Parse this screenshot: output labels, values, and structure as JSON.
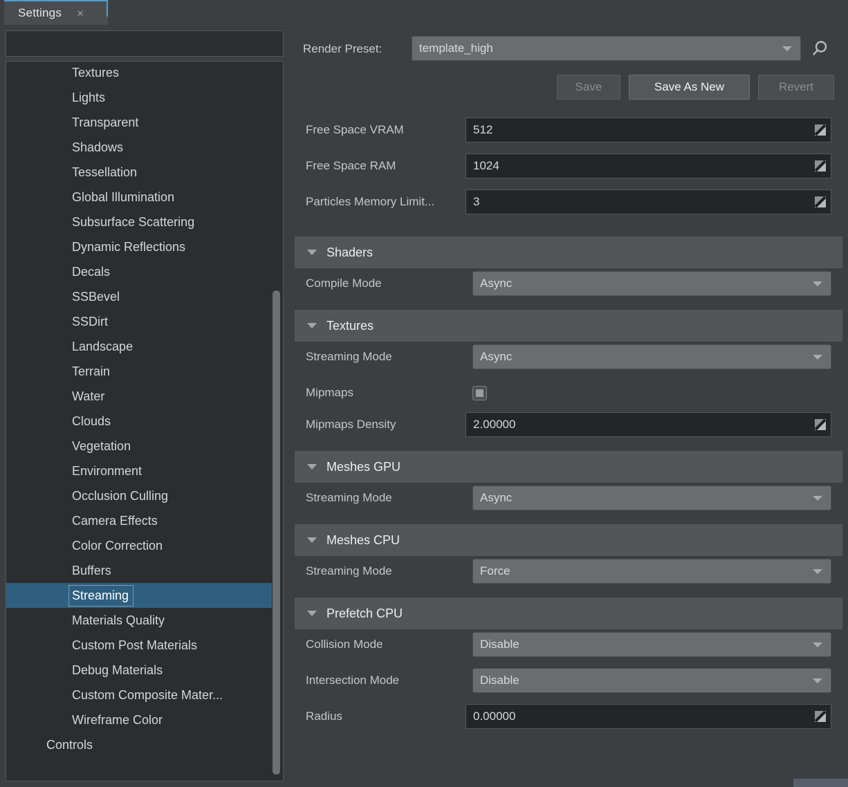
{
  "window": {
    "tab_label": "Settings",
    "close_icon": "close-icon"
  },
  "sidebar": {
    "search_placeholder": "",
    "search_value": "",
    "selected_item": "Streaming",
    "items": [
      {
        "label": "Textures",
        "level": 1
      },
      {
        "label": "Lights",
        "level": 1
      },
      {
        "label": "Transparent",
        "level": 1
      },
      {
        "label": "Shadows",
        "level": 1
      },
      {
        "label": "Tessellation",
        "level": 1
      },
      {
        "label": "Global Illumination",
        "level": 1
      },
      {
        "label": "Subsurface Scattering",
        "level": 1
      },
      {
        "label": "Dynamic Reflections",
        "level": 1
      },
      {
        "label": "Decals",
        "level": 1
      },
      {
        "label": "SSBevel",
        "level": 1
      },
      {
        "label": "SSDirt",
        "level": 1
      },
      {
        "label": "Landscape",
        "level": 1
      },
      {
        "label": "Terrain",
        "level": 1
      },
      {
        "label": "Water",
        "level": 1
      },
      {
        "label": "Clouds",
        "level": 1
      },
      {
        "label": "Vegetation",
        "level": 1
      },
      {
        "label": "Environment",
        "level": 1
      },
      {
        "label": "Occlusion Culling",
        "level": 1
      },
      {
        "label": "Camera Effects",
        "level": 1
      },
      {
        "label": "Color Correction",
        "level": 1
      },
      {
        "label": "Buffers",
        "level": 1
      },
      {
        "label": "Streaming",
        "level": 1,
        "selected": true
      },
      {
        "label": "Materials Quality",
        "level": 1
      },
      {
        "label": "Custom Post Materials",
        "level": 1
      },
      {
        "label": "Debug Materials",
        "level": 1
      },
      {
        "label": "Custom Composite Mater...",
        "level": 1
      },
      {
        "label": "Wireframe Color",
        "level": 1
      },
      {
        "label": "Controls",
        "level": 0
      }
    ]
  },
  "main": {
    "preset": {
      "label": "Render Preset:",
      "value": "template_high",
      "search_icon": "search-icon"
    },
    "buttons": {
      "save": {
        "label": "Save",
        "enabled": false
      },
      "save_as_new": {
        "label": "Save As New",
        "enabled": true
      },
      "revert": {
        "label": "Revert",
        "enabled": false
      }
    },
    "top_fields": [
      {
        "label": "Free Space VRAM",
        "value": "512",
        "type": "number"
      },
      {
        "label": "Free Space RAM",
        "value": "1024",
        "type": "number"
      },
      {
        "label": "Particles Memory Limit...",
        "value": "3",
        "type": "number"
      }
    ],
    "sections": [
      {
        "title": "Shaders",
        "expanded": true,
        "fields": [
          {
            "label": "Compile Mode",
            "value": "Async",
            "type": "select"
          }
        ]
      },
      {
        "title": "Textures",
        "expanded": true,
        "fields": [
          {
            "label": "Streaming Mode",
            "value": "Async",
            "type": "select"
          },
          {
            "label": "Mipmaps",
            "value": "",
            "type": "checkbox",
            "checked": true
          },
          {
            "label": "Mipmaps Density",
            "value": "2.00000",
            "type": "number"
          }
        ]
      },
      {
        "title": "Meshes GPU",
        "expanded": true,
        "fields": [
          {
            "label": "Streaming Mode",
            "value": "Async",
            "type": "select"
          }
        ]
      },
      {
        "title": "Meshes CPU",
        "expanded": true,
        "fields": [
          {
            "label": "Streaming Mode",
            "value": "Force",
            "type": "select"
          }
        ]
      },
      {
        "title": "Prefetch CPU",
        "expanded": true,
        "fields": [
          {
            "label": "Collision Mode",
            "value": "Disable",
            "type": "select"
          },
          {
            "label": "Intersection Mode",
            "value": "Disable",
            "type": "select"
          },
          {
            "label": "Radius",
            "value": "0.00000",
            "type": "number"
          }
        ]
      }
    ]
  },
  "colors": {
    "background": "#3c3f41",
    "panel_dark": "#2b2d2f",
    "section_header": "#535659",
    "accent_blue": "#4a9fd8",
    "selection_blue": "#2e5f80",
    "field_select": "#6a6d70",
    "field_input": "#232527"
  }
}
